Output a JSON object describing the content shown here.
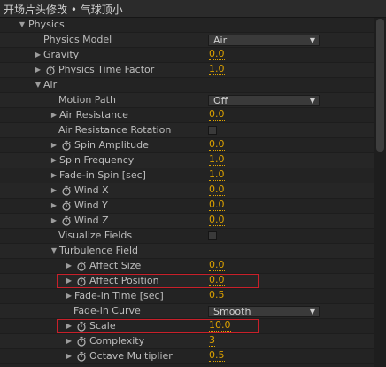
{
  "window": {
    "title": "开场片头修改 • 气球顶小"
  },
  "section": {
    "label": "Physics"
  },
  "rows": [
    {
      "label": "Physics Model",
      "control": "dropdown",
      "value": "Air"
    },
    {
      "label": "Gravity",
      "control": "value",
      "value": "0.0",
      "collapsed": true
    },
    {
      "label": "Physics Time Factor",
      "control": "value",
      "value": "1.0",
      "collapsed": true,
      "stopwatch": true
    },
    {
      "label": "Air",
      "control": "group",
      "expanded": true
    },
    {
      "label": "Motion Path",
      "control": "dropdown",
      "value": "Off"
    },
    {
      "label": "Air Resistance",
      "control": "value",
      "value": "0.0",
      "collapsed": true
    },
    {
      "label": "Air Resistance Rotation",
      "control": "checkbox",
      "checked": false
    },
    {
      "label": "Spin Amplitude",
      "control": "value",
      "value": "0.0",
      "collapsed": true,
      "stopwatch": true
    },
    {
      "label": "Spin Frequency",
      "control": "value",
      "value": "1.0",
      "collapsed": true
    },
    {
      "label": "Fade-in Spin [sec]",
      "control": "value",
      "value": "1.0",
      "collapsed": true
    },
    {
      "label": "Wind X",
      "control": "value",
      "value": "0.0",
      "collapsed": true,
      "stopwatch": true
    },
    {
      "label": "Wind Y",
      "control": "value",
      "value": "0.0",
      "collapsed": true,
      "stopwatch": true
    },
    {
      "label": "Wind Z",
      "control": "value",
      "value": "0.0",
      "collapsed": true,
      "stopwatch": true
    },
    {
      "label": "Visualize Fields",
      "control": "checkbox",
      "checked": false
    },
    {
      "label": "Turbulence Field",
      "control": "group",
      "expanded": true
    },
    {
      "label": "Affect Size",
      "control": "value",
      "value": "0.0",
      "collapsed": true,
      "stopwatch": true
    },
    {
      "label": "Affect Position",
      "control": "value",
      "value": "0.0",
      "collapsed": true,
      "stopwatch": true,
      "highlighted": true
    },
    {
      "label": "Fade-in Time [sec]",
      "control": "value",
      "value": "0.5",
      "collapsed": true
    },
    {
      "label": "Fade-in Curve",
      "control": "dropdown",
      "value": "Smooth"
    },
    {
      "label": "Scale",
      "control": "value",
      "value": "10.0",
      "collapsed": true,
      "stopwatch": true,
      "highlighted": true
    },
    {
      "label": "Complexity",
      "control": "value",
      "value": "3",
      "collapsed": true,
      "stopwatch": true
    },
    {
      "label": "Octave Multiplier",
      "control": "value",
      "value": "0.5",
      "collapsed": true,
      "stopwatch": true
    }
  ],
  "icons": {
    "expanded": "triangle-down-icon",
    "collapsed": "triangle-right-icon",
    "stopwatch": "stopwatch-icon",
    "dropdown": "dropdown-arrow-icon"
  },
  "colors": {
    "value": "#dba100",
    "highlight": "#c8202a",
    "background": "#232323",
    "label": "#bdbdbd"
  }
}
